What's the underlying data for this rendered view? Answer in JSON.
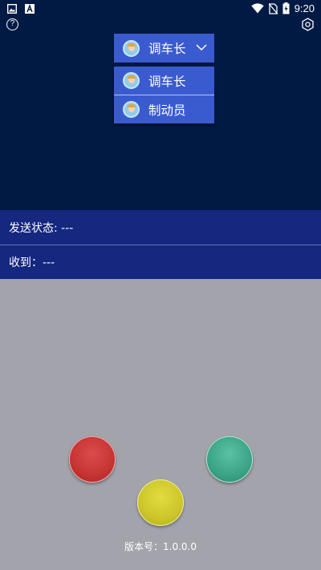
{
  "status_bar": {
    "time": "9:20",
    "left_icons": [
      "gallery-icon",
      "text-a-icon"
    ],
    "right_icons": [
      "wifi-icon",
      "no-sim-icon",
      "battery-charging-icon"
    ]
  },
  "toolbar": {
    "help_icon": "question-circle-icon",
    "help_glyph": "?",
    "settings_icon": "settings-hex-icon"
  },
  "role_selector": {
    "selected": "调车长",
    "options": [
      "调车长",
      "制动员"
    ]
  },
  "status": {
    "send_label": "发送状态: ---",
    "recv_label": "收到：---"
  },
  "signals": {
    "red": "#c53333",
    "green": "#3aa385",
    "yellow": "#cbc52a"
  },
  "colors": {
    "header_bg": "#001a44",
    "dropdown_bg": "#3a5bd0",
    "status_row_bg": "#15277e",
    "body_bg": "#a2a3ab"
  },
  "footer": {
    "version": "版本号：1.0.0.0"
  }
}
